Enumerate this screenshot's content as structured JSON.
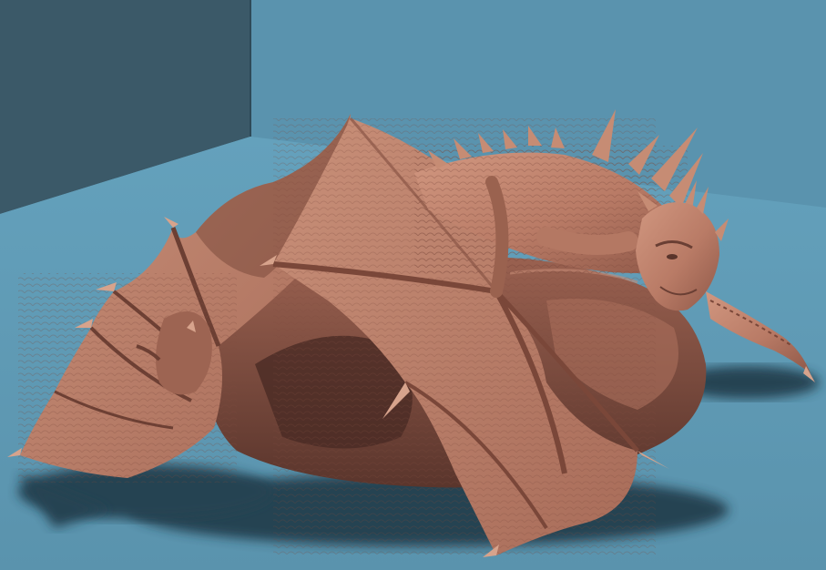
{
  "scene": {
    "subject": "",
    "colors": {
      "back_wall": "#5a93ae",
      "left_wall": "#3b5968",
      "floor": "#5f98b3",
      "shadow": "#1e3442",
      "clay_light": "#c88d76",
      "clay_mid": "#b37563",
      "clay_dark": "#6a3f34"
    }
  }
}
